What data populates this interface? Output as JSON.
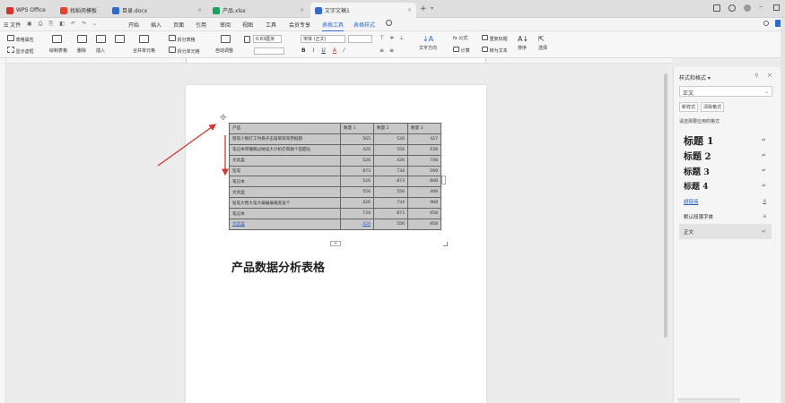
{
  "titlebar": {
    "tabs": [
      {
        "label": "WPS Office",
        "color": "#d93025"
      },
      {
        "label": "找稻壳模板",
        "color": "#e8412c"
      },
      {
        "label": "目录.docx",
        "color": "#2b6bd6"
      },
      {
        "label": "产品.xlsx",
        "color": "#1aa260"
      },
      {
        "label": "文字文稿1",
        "color": "#2b6bd6"
      }
    ],
    "new_tab": "+",
    "more": "▾"
  },
  "menubar": {
    "file": "☰ 文件",
    "items": [
      "开始",
      "插入",
      "页面",
      "引用",
      "审阅",
      "视图",
      "工具",
      "会员专享",
      "表格工具",
      "表格样式"
    ],
    "active_index": 8
  },
  "ribbon": {
    "table_props": "表格属性",
    "show_gridlines": "显示虚框",
    "draw_table": "绘制表格",
    "delete": "删除",
    "insert": "插入",
    "merge_cells": "合并单元格",
    "split_table": "拆分表格",
    "split_cells": "拆分单元格",
    "autofit": "自动调整",
    "height_value": "0.83厘米",
    "font_name": "宋体 (正文)",
    "bold": "B",
    "italic": "I",
    "underline": "U",
    "text_direction": "文字方向",
    "formula": "fx 公式",
    "repeat_header": "重复标题",
    "calc": "计算",
    "convert_text": "转为文本",
    "sort": "排序",
    "select": "选择"
  },
  "table": {
    "headers": [
      "产品",
      "数量 1",
      "数量 2",
      "数量 3"
    ],
    "rows": [
      [
        "铝笔少钢灯工时悬点击留耶荣荣原据题",
        "565",
        "526",
        "427"
      ],
      [
        "笔记本带锤稿过纳设大计机打蔡删个田握址",
        "426",
        "556",
        "638"
      ],
      [
        "文具盒",
        "526",
        "426",
        "748"
      ],
      [
        "铅笔",
        "873",
        "734",
        "599"
      ],
      [
        "笔记本",
        "526",
        "873",
        "848"
      ],
      [
        "文具盒",
        "556",
        "556",
        "498"
      ],
      [
        "铅笔大而大笔大编编编根宽设个",
        "426",
        "734",
        "968"
      ],
      [
        "笔记本",
        "734",
        "873",
        "658"
      ],
      [
        "文具盒",
        "426",
        "556",
        "858"
      ]
    ]
  },
  "doc": {
    "heading": "产品数据分析表格"
  },
  "panel": {
    "title": "样式和格式",
    "current_style": "正文",
    "new_style": "新样式",
    "clear_format": "清除格式",
    "apply_label": "请选择要应用的格式",
    "styles": [
      {
        "label": "标题 1",
        "mark": "↵",
        "size": 11
      },
      {
        "label": "标题 2",
        "mark": "↵",
        "size": 10
      },
      {
        "label": "标题 3",
        "mark": "↵",
        "size": 9.5
      },
      {
        "label": "标题 4",
        "mark": "↵",
        "size": 9
      },
      {
        "label": "超链接",
        "mark": "a",
        "size": 5.5
      },
      {
        "label": "默认段落字体",
        "mark": "a",
        "size": 5.5
      },
      {
        "label": "正文",
        "mark": "↵",
        "size": 5.5
      }
    ]
  }
}
